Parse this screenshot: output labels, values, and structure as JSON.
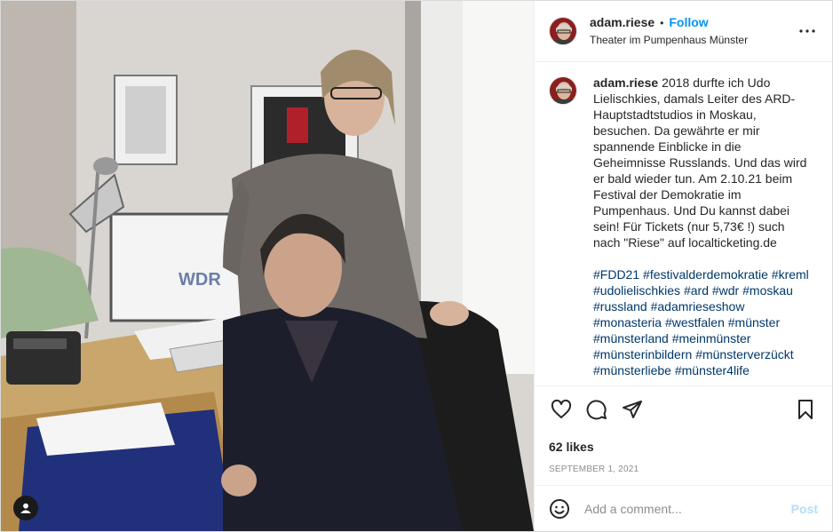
{
  "post": {
    "username": "adam.riese",
    "separator": "•",
    "follow_label": "Follow",
    "location": "Theater im Pumpenhaus Münster",
    "caption": "2018 durfte ich Udo Lielischkies, damals Leiter des ARD-Hauptstadtstudios in Moskau, besuchen. Da gewährte er mir spannende Einblicke in die Geheimnisse Russlands. Und das wird er bald wieder tun. Am 2.10.21 beim Festival der Demokratie im Pumpenhaus. Und Du kannst dabei sein! Für Tickets (nur 5,73€ !) such nach \"Riese\" auf localticketing.de",
    "hashtags": [
      "#FDD21",
      "#festivalderdemokratie",
      "#kreml",
      "#udolielischkies",
      "#ard",
      "#wdr",
      "#moskau",
      "#russland",
      "#adamrieseshow",
      "#monasteria",
      "#westfalen",
      "#münster",
      "#münsterland",
      "#meinmünster",
      "#münsterinbildern",
      "#münsterverzückt",
      "#münsterliebe",
      "#münster4life"
    ],
    "likes": "62 likes",
    "date": "SEPTEMBER 1, 2021",
    "photo_sign_text": "WDR"
  },
  "comment_box": {
    "placeholder": "Add a comment...",
    "post_label": "Post"
  },
  "icons": {
    "more": "more-options-icon",
    "like": "heart-icon",
    "comment": "comment-icon",
    "share": "paper-plane-icon",
    "save": "bookmark-icon",
    "emoji": "emoji-icon",
    "tag": "user-tag-icon"
  },
  "colors": {
    "accent": "#0095f6",
    "hashtag": "#00376b",
    "muted": "#8e8e8e",
    "post_disabled": "#b2dffc",
    "border": "#dbdbdb"
  }
}
